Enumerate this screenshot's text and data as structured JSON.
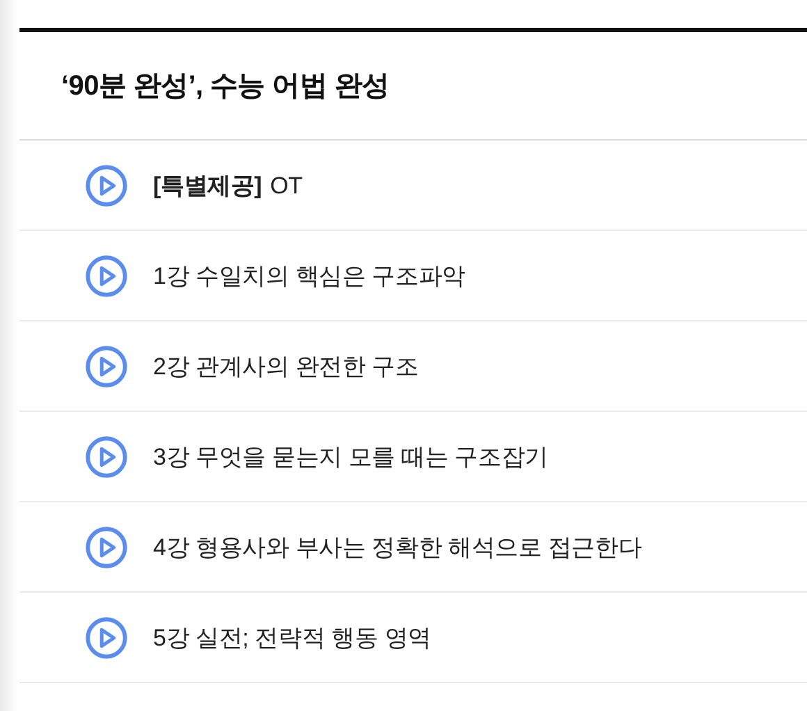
{
  "section": {
    "title": "‘90분 완성’, 수능 어법 완성"
  },
  "lectures": [
    {
      "tag": "[특별제공]",
      "title": "OT"
    },
    {
      "title": "1강 수일치의 핵심은 구조파악"
    },
    {
      "title": "2강 관계사의 완전한 구조"
    },
    {
      "title": "3강 무엇을 묻는지 모를 때는 구조잡기"
    },
    {
      "title": "4강 형용사와 부사는 정확한 해석으로 접근한다"
    },
    {
      "title": "5강 실전; 전략적 행동 영역"
    }
  ]
}
